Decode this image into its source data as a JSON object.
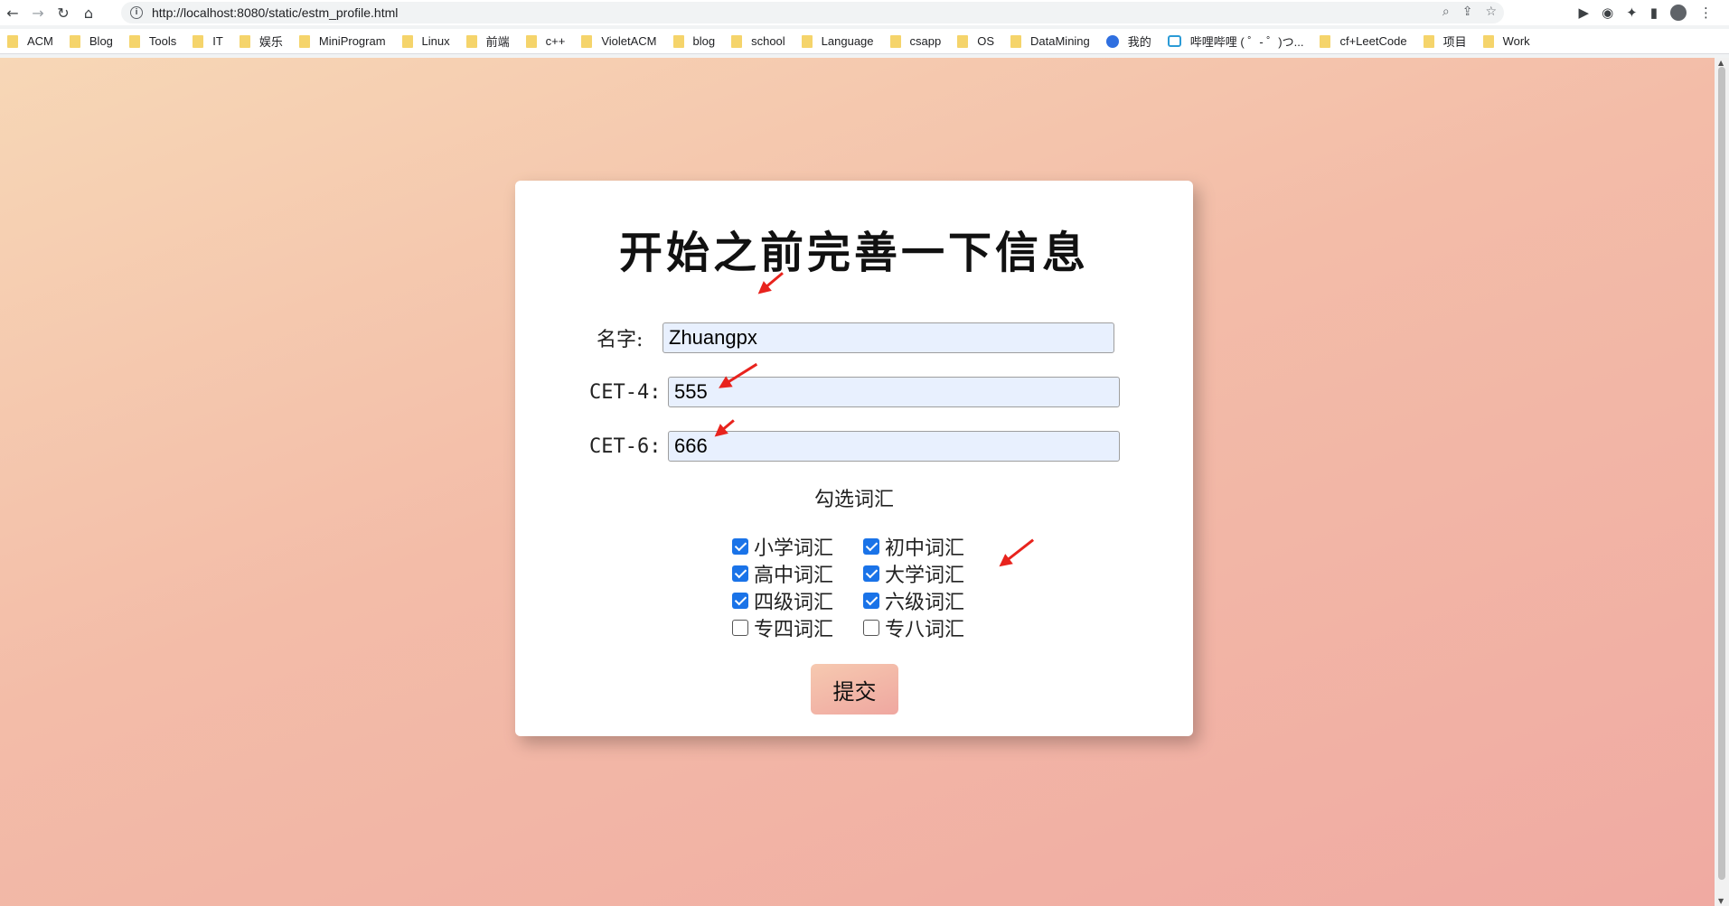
{
  "browser": {
    "url": "http://localhost:8080/static/estm_profile.html",
    "bookmarks": [
      "ACM",
      "Blog",
      "Tools",
      "IT",
      "娱乐",
      "MiniProgram",
      "Linux",
      "前端",
      "c++",
      "VioletACM",
      "blog",
      "school",
      "Language",
      "csapp",
      "OS",
      "DataMining",
      "我的",
      "哔哩哔哩 ( ゜- ゜)つ...",
      "cf+LeetCode",
      "项目",
      "Work"
    ]
  },
  "form": {
    "title": "开始之前完善一下信息",
    "name_label": "名字:",
    "name_value": "Zhuangpx",
    "cet4_label": "CET-4:",
    "cet4_value": "555",
    "cet6_label": "CET-6:",
    "cet6_value": "666",
    "vocab_heading": "勾选词汇",
    "vocab_options": [
      {
        "label": "小学词汇",
        "checked": true
      },
      {
        "label": "初中词汇",
        "checked": true
      },
      {
        "label": "高中词汇",
        "checked": true
      },
      {
        "label": "大学词汇",
        "checked": true
      },
      {
        "label": "四级词汇",
        "checked": true
      },
      {
        "label": "六级词汇",
        "checked": true
      },
      {
        "label": "专四词汇",
        "checked": false
      },
      {
        "label": "专八词汇",
        "checked": false
      }
    ],
    "submit_label": "提交"
  },
  "colors": {
    "accent": "#1a73e8",
    "annotation_arrow": "#e8231d"
  }
}
